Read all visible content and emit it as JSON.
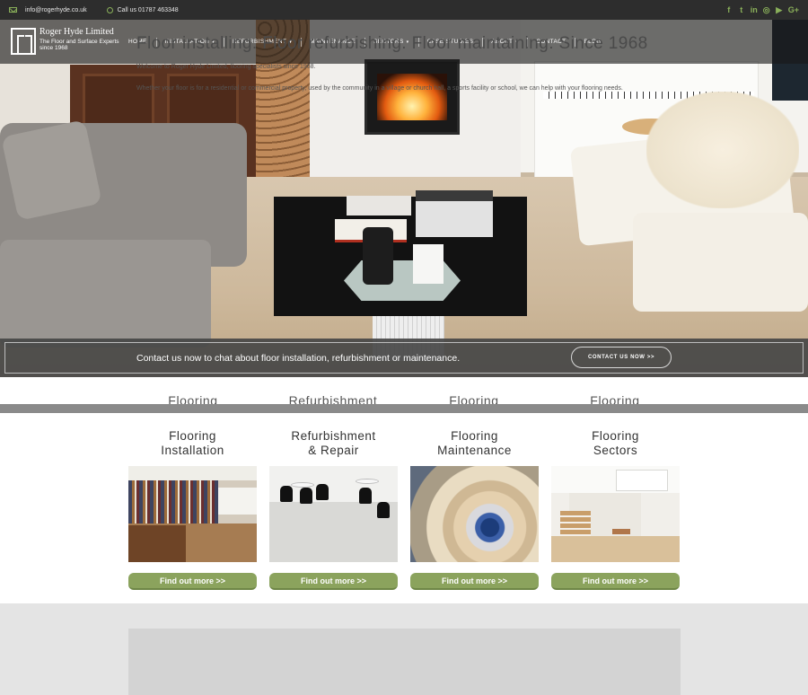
{
  "topbar": {
    "email": "info@rogerhyde.co.uk",
    "phone": "Call us 01787 463348",
    "social": [
      {
        "icon": "facebook-icon",
        "glyph": "f"
      },
      {
        "icon": "twitter-icon",
        "glyph": "t"
      },
      {
        "icon": "linkedin-icon",
        "glyph": "in"
      },
      {
        "icon": "instagram-icon",
        "glyph": "◎"
      },
      {
        "icon": "youtube-icon",
        "glyph": "▶"
      },
      {
        "icon": "google-plus-icon",
        "glyph": "G+"
      }
    ],
    "accent": "#8ab05a"
  },
  "logo": {
    "title": "Roger Hyde Limited",
    "tagline": "The Floor and Surface Experts",
    "since": "since 1968"
  },
  "nav": {
    "items": [
      {
        "label": "HOME",
        "dropdown": false
      },
      {
        "label": "INSTALLATION",
        "dropdown": true
      },
      {
        "label": "REFURBISHMENT",
        "dropdown": true
      },
      {
        "label": "MAINTENANCE",
        "dropdown": false
      },
      {
        "label": "SECTORS",
        "dropdown": true
      },
      {
        "label": "CASE STUDIES",
        "dropdown": false
      },
      {
        "label": "ABOUT",
        "dropdown": true
      },
      {
        "label": "CONTACT",
        "dropdown": false
      },
      {
        "label": "BLOG",
        "dropdown": false
      }
    ],
    "dropdown_glyph": "▾"
  },
  "cta": {
    "text": "Contact us now to chat about floor installation, refurbishment or maintenance.",
    "button": "CONTACT US NOW >>"
  },
  "ghost_titles": [
    "Flooring",
    "Refurbishment",
    "Flooring",
    "Flooring"
  ],
  "services": [
    {
      "line1": "Flooring",
      "line2": "Installation",
      "button": "Find out more >>"
    },
    {
      "line1": "Refurbishment",
      "line2": "& Repair",
      "button": "Find out more >>"
    },
    {
      "line1": "Flooring",
      "line2": "Maintenance",
      "button": "Find out more >>"
    },
    {
      "line1": "Flooring",
      "line2": "Sectors",
      "button": "Find out more >>"
    }
  ],
  "button_color": "#8ba35d",
  "about": {
    "title": "Floor installing. Floor refurbishing. Floor maintaining. Since 1968",
    "p1": "Welcome to Roger Hyde Limited, flooring specialists since 1968.",
    "p2": "Whether your floor is for a residential or commercial property, used by the community in a village or church hall, a sports facility or school, we can help with your flooring needs."
  }
}
